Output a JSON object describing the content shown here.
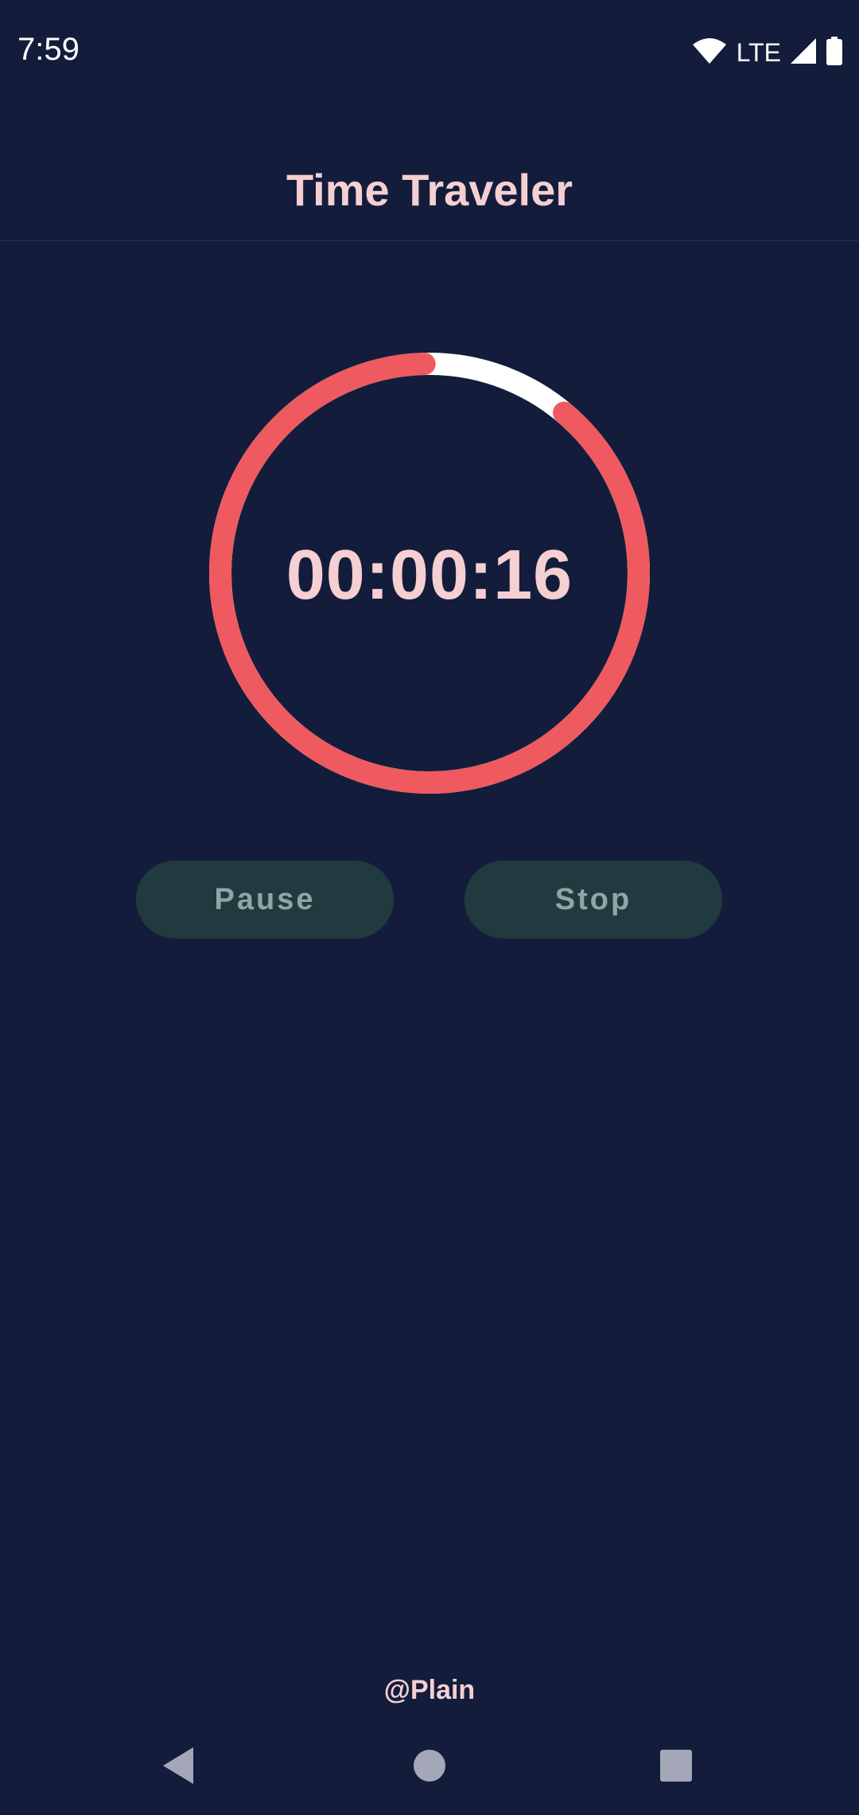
{
  "status_bar": {
    "time": "7:59",
    "network": "LTE",
    "icons": [
      "wifi-icon",
      "cell-signal-icon",
      "battery-icon"
    ]
  },
  "header": {
    "title": "Time Traveler"
  },
  "timer": {
    "display": "00:00:16",
    "progress_fraction": 0.885,
    "colors": {
      "progress": "#ee5a5f",
      "track": "#ffffff"
    }
  },
  "controls": {
    "pause_label": "Pause",
    "stop_label": "Stop"
  },
  "footer": {
    "handle": "@Plain"
  },
  "nav_bar": {
    "icons": [
      "back-icon",
      "home-icon",
      "recents-icon"
    ]
  },
  "colors": {
    "background": "#131d3b",
    "accent_text": "#f5cfd2",
    "button_bg": "#213a3f",
    "button_text": "#8ba8a5"
  }
}
